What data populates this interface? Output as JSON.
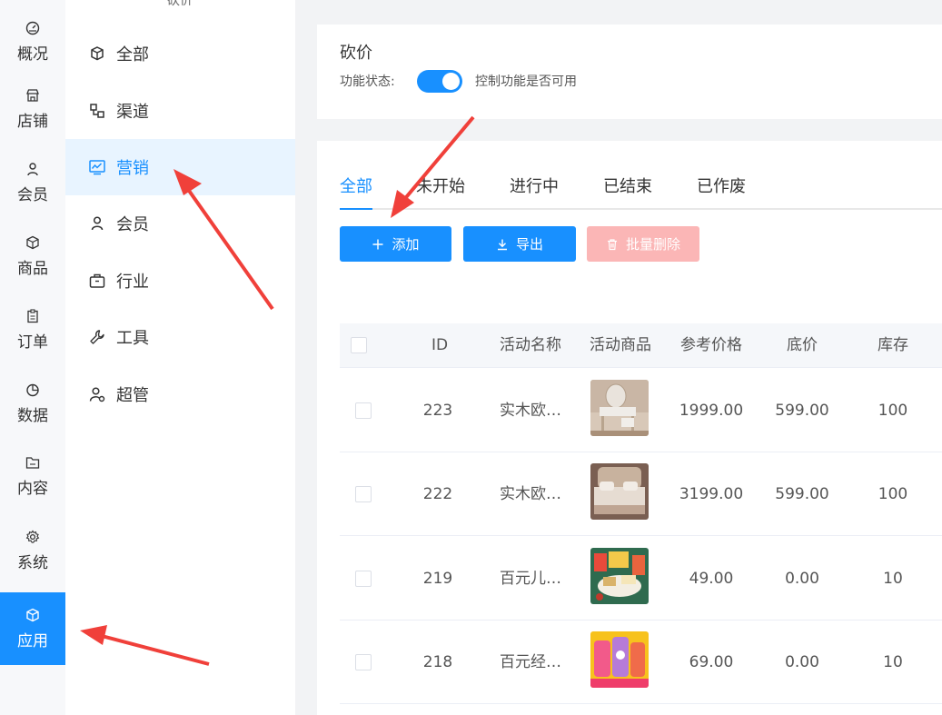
{
  "rail": {
    "items": [
      {
        "label": "概况",
        "icon": "dashboard-icon"
      },
      {
        "label": "店铺",
        "icon": "store-icon"
      },
      {
        "label": "会员",
        "icon": "user-icon"
      },
      {
        "label": "商品",
        "icon": "box-icon"
      },
      {
        "label": "订单",
        "icon": "clipboard-icon"
      },
      {
        "label": "数据",
        "icon": "pie-chart-icon"
      },
      {
        "label": "内容",
        "icon": "folder-icon"
      },
      {
        "label": "系统",
        "icon": "gear-icon"
      },
      {
        "label": "应用",
        "icon": "cube-icon"
      }
    ],
    "active_index": 8
  },
  "submenu": {
    "title": "砍价",
    "items": [
      {
        "label": "全部",
        "icon": "cube-icon"
      },
      {
        "label": "渠道",
        "icon": "channel-icon"
      },
      {
        "label": "营销",
        "icon": "chart-line-icon"
      },
      {
        "label": "会员",
        "icon": "user-icon"
      },
      {
        "label": "行业",
        "icon": "briefcase-icon"
      },
      {
        "label": "工具",
        "icon": "wrench-icon"
      },
      {
        "label": "超管",
        "icon": "admin-user-icon"
      }
    ],
    "active_index": 2
  },
  "header": {
    "title": "砍价",
    "status_label": "功能状态:",
    "status_on": true,
    "status_desc": "控制功能是否可用"
  },
  "tabs": {
    "items": [
      "全部",
      "未开始",
      "进行中",
      "已结束",
      "已作废"
    ],
    "active_index": 0
  },
  "toolbar": {
    "add_label": "添加",
    "export_label": "导出",
    "delete_label": "批量删除"
  },
  "table": {
    "columns": [
      "ID",
      "活动名称",
      "活动商品",
      "参考价格",
      "底价",
      "库存"
    ],
    "rows": [
      {
        "id": "223",
        "name": "实木欧…",
        "price": "1999.00",
        "floor": "599.00",
        "stock": "100",
        "thumb": "dresser"
      },
      {
        "id": "222",
        "name": "实木欧…",
        "price": "3199.00",
        "floor": "599.00",
        "stock": "100",
        "thumb": "bed"
      },
      {
        "id": "219",
        "name": "百元儿…",
        "price": "49.00",
        "floor": "0.00",
        "stock": "10",
        "thumb": "snacks"
      },
      {
        "id": "218",
        "name": "百元经…",
        "price": "69.00",
        "floor": "0.00",
        "stock": "10",
        "thumb": "toys"
      }
    ]
  },
  "colors": {
    "accent": "#1890ff",
    "active_bg": "#e8f4ff",
    "danger_disabled": "#fbb6b6",
    "annotation_arrow": "#f0403a"
  }
}
